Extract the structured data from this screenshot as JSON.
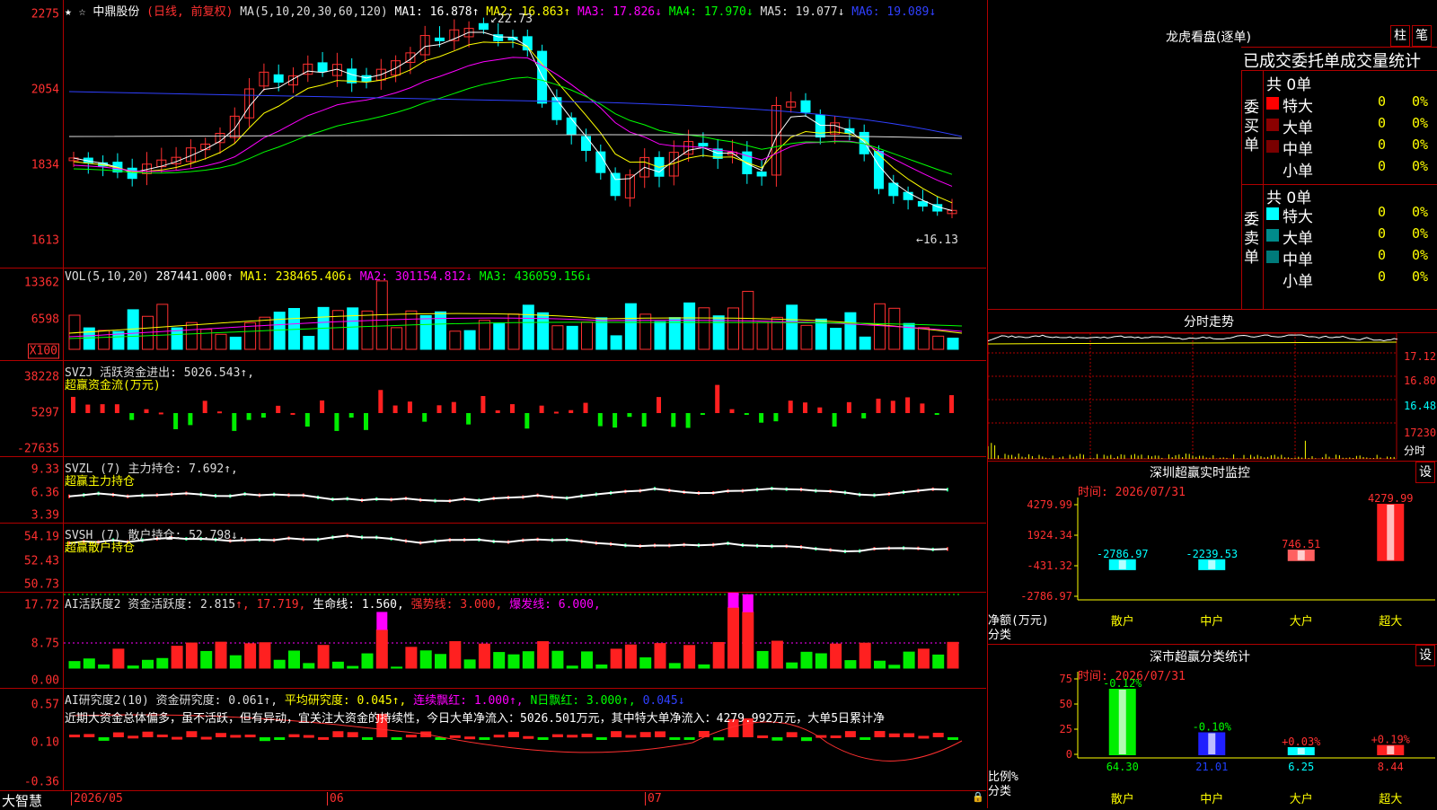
{
  "main_chart": {
    "stock": "中鼎股份",
    "mode": "(日线, 前复权)",
    "ma_label": "MA(5,10,20,30,60,120)",
    "ma1": "MA1: 16.878↑",
    "ma2": "MA2: 16.863↑",
    "ma3": "MA3: 17.826↓",
    "ma4": "MA4: 17.970↓",
    "ma5": "MA5: 19.077↓",
    "ma6": "MA6: 19.089↓",
    "high_label": "22.73",
    "low_label": "16.13",
    "yaxis": [
      "2275",
      "2054",
      "1834",
      "1613"
    ]
  },
  "vol_panel": {
    "title": "VOL(5,10,20)",
    "value": "287441.000↑",
    "ma1": "MA1: 238465.406↓",
    "ma2": "MA2: 301154.812↓",
    "ma3": "MA3: 436059.156↓",
    "yaxis": [
      "13362",
      "6598",
      "X100"
    ]
  },
  "svzj": {
    "title": "SVZJ  活跃资金进出: 5026.543↑,",
    "subtitle": "超赢资金流(万元)",
    "yaxis": [
      "38228",
      "5297",
      "-27635"
    ]
  },
  "svzl": {
    "title": "SVZL (7) 主力持仓: 7.692↑,",
    "subtitle": "超赢主力持仓",
    "yaxis": [
      "9.33",
      "6.36",
      "3.39"
    ]
  },
  "svsh": {
    "title": "SVSH (7) 散户持仓: 52.798↓,",
    "subtitle": "超赢散户持仓",
    "yaxis": [
      "54.19",
      "52.43",
      "50.73"
    ]
  },
  "ai_active": {
    "title": "AI活跃度2 资金活跃度: 2.815",
    "v2": "↑, 17.719,",
    "v3": "生命线: 1.560,",
    "v4": "强势线: 3.000,",
    "v5": "爆发线: 6.000,",
    "yaxis": [
      "17.72",
      "8.75",
      "0.00"
    ]
  },
  "ai_research": {
    "title": "AI研究度2(10) 资金研究度: 0.061↑,",
    "v2": "平均研究度: 0.045↑,",
    "v3": "连续飘红: 1.000↑,",
    "v4": "N日飘红: 3.000↑,",
    "v5": "0.045↓",
    "note": "近期大资金总体偏多，虽不活跃，但有异动，宜关注大资金的持续性，今日大单净流入：5026.501万元，其中特大单净流入：4279.992万元，大单5日累计净",
    "yaxis": [
      "0.57",
      "0.10",
      "-0.36"
    ]
  },
  "bottom_axis": {
    "brand": "大智慧",
    "dates": [
      "2026/05",
      "06",
      "07"
    ]
  },
  "dragon_tiger": {
    "title": "龙虎看盘(逐单)",
    "btn1": "柱",
    "btn2": "笔",
    "subtitle": "已成交委托单成交量统计",
    "buy_label": "委买单",
    "sell_label": "委卖单",
    "buy_total": "共 0单",
    "sell_total": "共 0单",
    "rows": [
      {
        "name": "特大",
        "count": "0",
        "pct": "0%"
      },
      {
        "name": "大单",
        "count": "0",
        "pct": "0%"
      },
      {
        "name": "中单",
        "count": "0",
        "pct": "0%"
      },
      {
        "name": "小单",
        "count": "0",
        "pct": "0%"
      }
    ],
    "colors_buy": [
      "#ff0000",
      "#8b0000",
      "#7a0000",
      "#000000"
    ],
    "colors_sell": [
      "#00ffff",
      "#008b8b",
      "#007a7a",
      "#000000"
    ]
  },
  "intraday": {
    "title": "分时走势",
    "yaxis": [
      "17.12",
      "16.80",
      "16.48",
      "17230"
    ],
    "xlabel": "分时"
  },
  "monitor": {
    "title": "深圳超赢实时监控",
    "btn": "设",
    "time": "时间: 2026/07/31",
    "yaxis": [
      "4279.99",
      "1924.34",
      "-431.32",
      "-2786.97"
    ],
    "ylabel": "净额(万元)",
    "xlabel": "分类",
    "categories": [
      "散户",
      "中户",
      "大户",
      "超大"
    ],
    "bar_labels": [
      "-2786.97",
      "-2239.53",
      "746.51",
      "4279.99"
    ]
  },
  "chart_data": [
    {
      "type": "bar",
      "title": "深圳超赢实时监控",
      "categories": [
        "散户",
        "中户",
        "大户",
        "超大"
      ],
      "values": [
        -2786.97,
        -2239.53,
        746.51,
        4279.99
      ],
      "ylabel": "净额(万元)",
      "ylim": [
        -2786.97,
        4279.99
      ]
    },
    {
      "type": "bar",
      "title": "深市超赢分类统计",
      "categories": [
        "散户",
        "中户",
        "大户",
        "超大"
      ],
      "values": [
        64.3,
        21.01,
        6.25,
        8.44
      ],
      "ylabel": "比例%",
      "ylim": [
        0,
        75
      ]
    }
  ],
  "stats": {
    "title": "深市超赢分类统计",
    "btn": "设",
    "time": "时间: 2026/07/31",
    "yaxis": [
      "75",
      "50",
      "25",
      "0"
    ],
    "ylabel": "比例%",
    "xlabel": "分类",
    "categories": [
      "散户",
      "中户",
      "大户",
      "超大"
    ],
    "changes": [
      "-0.12%",
      "-0.10%",
      "+0.03%",
      "+0.19%"
    ],
    "values": [
      "64.30",
      "21.01",
      "6.25",
      "8.44"
    ]
  }
}
